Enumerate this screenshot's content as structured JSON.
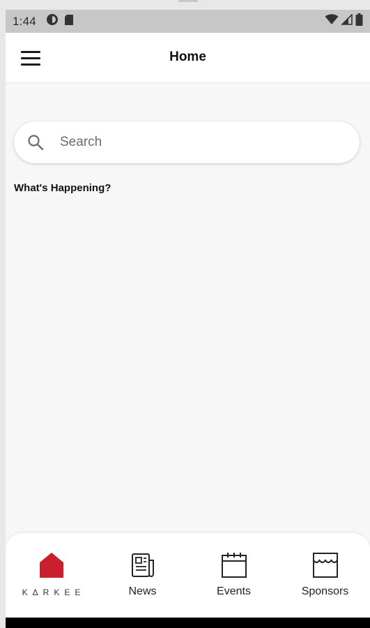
{
  "status_bar": {
    "time": "1:44",
    "left_icons": [
      "data-saver-icon",
      "sd-card-icon"
    ],
    "right_icons": [
      "wifi-icon",
      "signal-icon",
      "battery-icon"
    ]
  },
  "app_bar": {
    "menu_icon": "hamburger-menu-icon",
    "title": "Home"
  },
  "search": {
    "placeholder": "Search",
    "value": ""
  },
  "section": {
    "heading": "What's Happening?"
  },
  "bottom_nav": {
    "items": [
      {
        "label": "KΔRKEE",
        "icon": "karkee-home-logo-icon",
        "active": true
      },
      {
        "label": "News",
        "icon": "newspaper-icon",
        "active": false
      },
      {
        "label": "Events",
        "icon": "calendar-icon",
        "active": false
      },
      {
        "label": "Sponsors",
        "icon": "storefront-icon",
        "active": false
      }
    ]
  },
  "colors": {
    "accent": "#c8202f",
    "status_bar": "#c7c7c7",
    "background": "#f7f7f7"
  }
}
